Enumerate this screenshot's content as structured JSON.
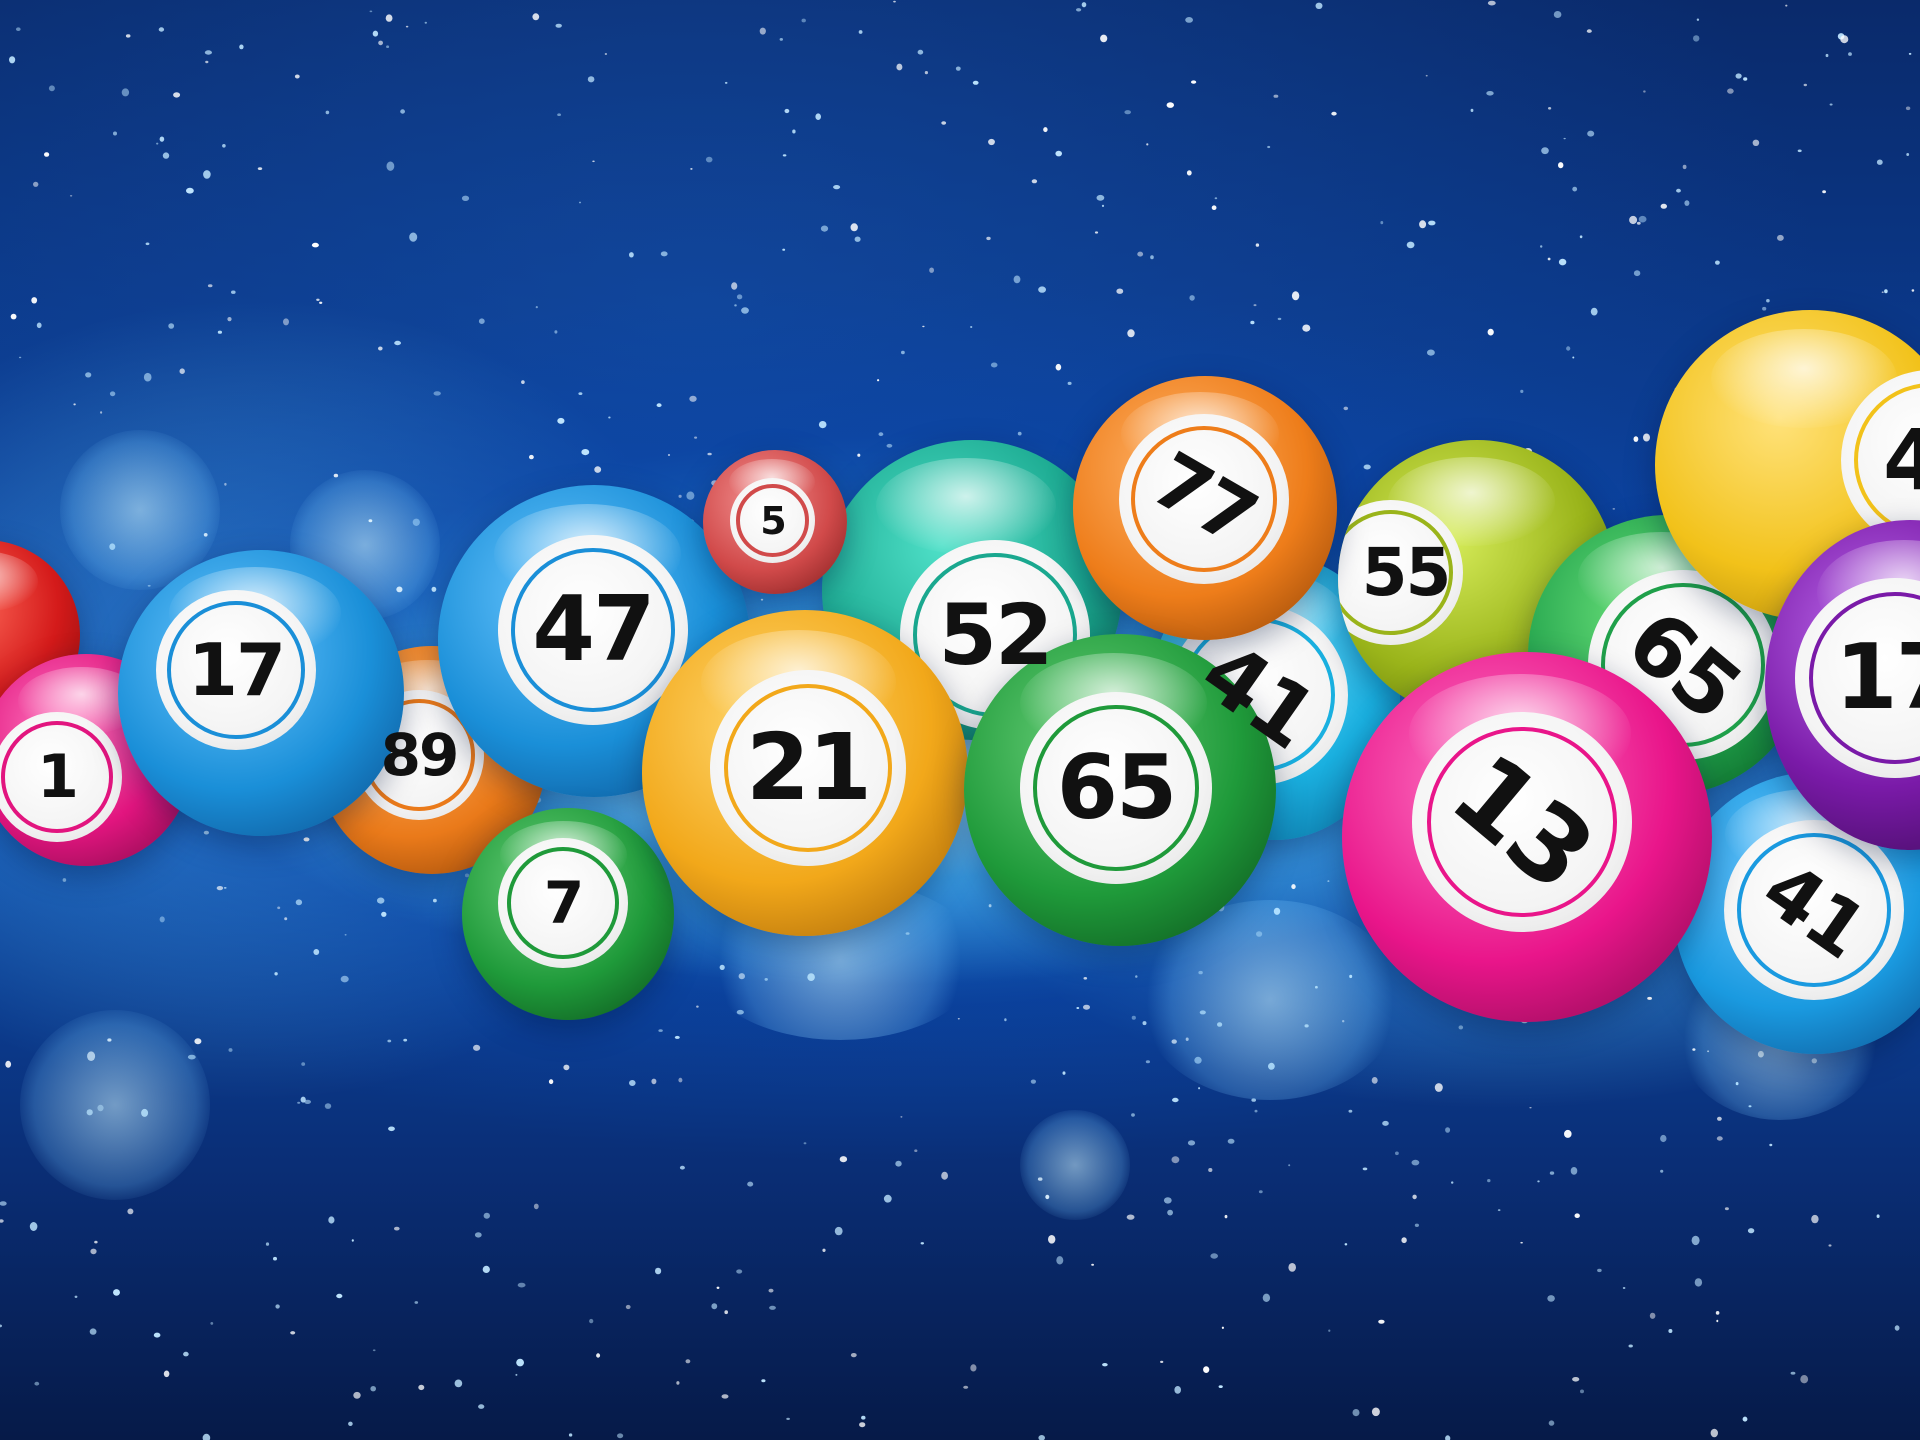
{
  "balls": [
    {
      "number": "1",
      "color": "#e2157f"
    },
    {
      "number": "17",
      "color": "#1a8fd8"
    },
    {
      "number": "89",
      "color": "#ea7a1a"
    },
    {
      "number": "47",
      "color": "#1a8fd8"
    },
    {
      "number": "5",
      "color": "#d14a4a"
    },
    {
      "number": "7",
      "color": "#1f9a3a"
    },
    {
      "number": "21",
      "color": "#f2a81a"
    },
    {
      "number": "52",
      "color": "#1aa88f"
    },
    {
      "number": "77",
      "color": "#ee7d1a"
    },
    {
      "number": "65",
      "color": "#1f9a3a"
    },
    {
      "number": "41",
      "color": "#1ab0e0"
    },
    {
      "number": "55",
      "color": "#9ab41a"
    },
    {
      "number": "13",
      "color": "#e9158a"
    },
    {
      "number": "65",
      "color": "#1fa04a"
    },
    {
      "number": "4",
      "color": "#f2c21a"
    },
    {
      "number": "17",
      "color": "#7a1aa8"
    },
    {
      "number": "41",
      "color": "#1a9ae0"
    }
  ]
}
